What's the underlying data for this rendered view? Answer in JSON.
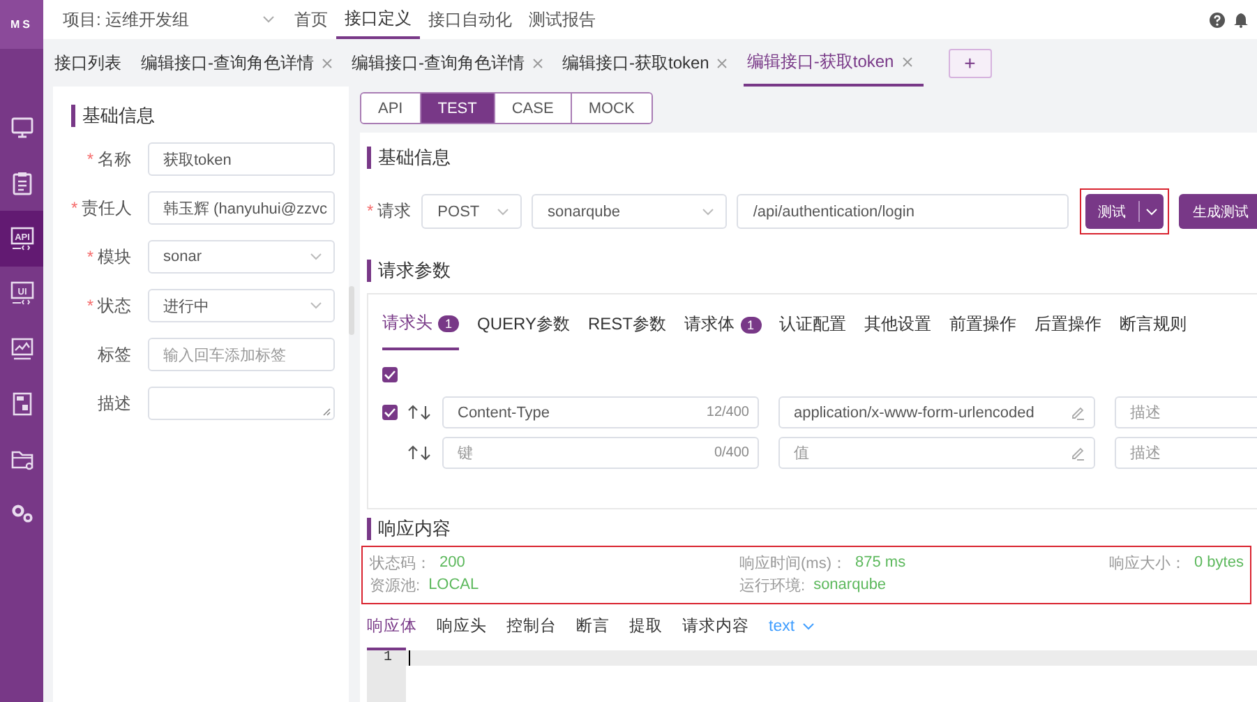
{
  "logo": "MS",
  "sidebar": {
    "items": [
      {
        "kind": "monitor",
        "selected": false
      },
      {
        "kind": "clipboard",
        "selected": false
      },
      {
        "kind": "code",
        "label": "API",
        "selected": true
      },
      {
        "kind": "code",
        "label": "UI",
        "selected": false
      },
      {
        "kind": "chart",
        "selected": false
      },
      {
        "kind": "report",
        "selected": false
      },
      {
        "kind": "folder",
        "selected": false
      },
      {
        "kind": "gears",
        "selected": false
      }
    ]
  },
  "project": {
    "label": "项目: 运维开发组"
  },
  "nav": [
    {
      "label": "首页",
      "selected": false
    },
    {
      "label": "接口定义",
      "selected": true
    },
    {
      "label": "接口自动化",
      "selected": false
    },
    {
      "label": "测试报告",
      "selected": false
    }
  ],
  "header_icons": [
    {
      "kind": "help"
    },
    {
      "kind": "bell"
    }
  ],
  "tabs": [
    {
      "label": "接口列表",
      "closable": false,
      "selected": false
    },
    {
      "label": "编辑接口-查询角色详情",
      "closable": true,
      "selected": false
    },
    {
      "label": "编辑接口-查询角色详情",
      "closable": true,
      "selected": false
    },
    {
      "label": "编辑接口-获取token",
      "closable": true,
      "selected": false
    },
    {
      "label": "编辑接口-获取token",
      "closable": true,
      "selected": true
    }
  ],
  "add_tab": "+",
  "basic_info": {
    "title": "基础信息",
    "fields": [
      {
        "label": "名称",
        "required_mark": "*",
        "kind": "input",
        "value": "获取token"
      },
      {
        "label": "责任人",
        "required_mark": "*",
        "kind": "select",
        "value": "韩玉辉 (hanyuhui@zzvc"
      },
      {
        "label": "模块",
        "required_mark": "*",
        "kind": "select",
        "value": "sonar"
      },
      {
        "label": "状态",
        "required_mark": "*",
        "kind": "select",
        "value": "进行中"
      },
      {
        "label": "标签",
        "kind": "input",
        "placeholder": "输入回车添加标签"
      },
      {
        "label": "描述",
        "kind": "textarea"
      }
    ]
  },
  "modes": [
    {
      "label": "API",
      "selected": false
    },
    {
      "label": "TEST",
      "selected": true
    },
    {
      "label": "CASE",
      "selected": false
    },
    {
      "label": "MOCK",
      "selected": false
    }
  ],
  "request": {
    "title": "基础信息",
    "label": "请求",
    "required_mark": "*",
    "method": "POST",
    "environment": "sonarqube",
    "path": "/api/authentication/login",
    "test_button": "测试",
    "generate_button": "生成测试"
  },
  "params": {
    "title": "请求参数",
    "tabs": [
      {
        "label": "请求头",
        "badge": "1",
        "selected": true
      },
      {
        "label": "QUERY参数",
        "selected": false
      },
      {
        "label": "REST参数",
        "selected": false
      },
      {
        "label": "请求体",
        "badge": "1",
        "selected": false
      },
      {
        "label": "认证配置",
        "selected": false
      },
      {
        "label": "其他设置",
        "selected": false
      },
      {
        "label": "前置操作",
        "selected": false
      },
      {
        "label": "后置操作",
        "selected": false
      },
      {
        "label": "断言规则",
        "selected": false
      }
    ],
    "all_checked": true,
    "rows": [
      {
        "kind": "entry",
        "checked": true,
        "key": "Content-Type",
        "count": "12/400",
        "value": "application/x-www-form-urlencoded",
        "description_placeholder": "描述"
      },
      {
        "kind": "new",
        "key_placeholder": "键",
        "count": "0/400",
        "value_placeholder": "值",
        "description_placeholder": "描述"
      }
    ]
  },
  "response": {
    "title": "响应内容",
    "info": [
      {
        "label": "状态码：",
        "value": "200"
      },
      {
        "label": "响应时间(ms)：",
        "value": "875 ms"
      },
      {
        "label": "响应大小：",
        "value": "0 bytes"
      },
      {
        "label": "资源池:",
        "value": "LOCAL"
      },
      {
        "label": "运行环境:",
        "value": "sonarqube"
      }
    ],
    "tabs": [
      {
        "label": "响应体",
        "kind": "tab",
        "selected": true
      },
      {
        "label": "响应头",
        "kind": "tab",
        "selected": false
      },
      {
        "label": "控制台",
        "kind": "tab",
        "selected": false
      },
      {
        "label": "断言",
        "kind": "tab",
        "selected": false
      },
      {
        "label": "提取",
        "kind": "tab",
        "selected": false
      },
      {
        "label": "请求内容",
        "kind": "tab",
        "selected": false
      },
      {
        "label": "text",
        "kind": "format"
      }
    ],
    "line_numbers": [
      "1"
    ]
  }
}
